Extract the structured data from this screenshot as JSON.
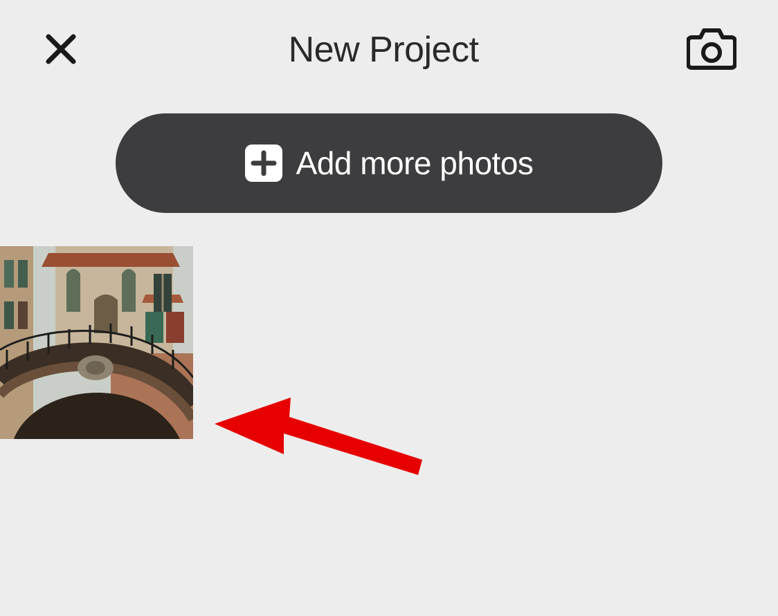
{
  "header": {
    "title": "New Project"
  },
  "buttons": {
    "add_more_photos": "Add more photos"
  },
  "annotation": {
    "arrow_color": "#e60000"
  }
}
